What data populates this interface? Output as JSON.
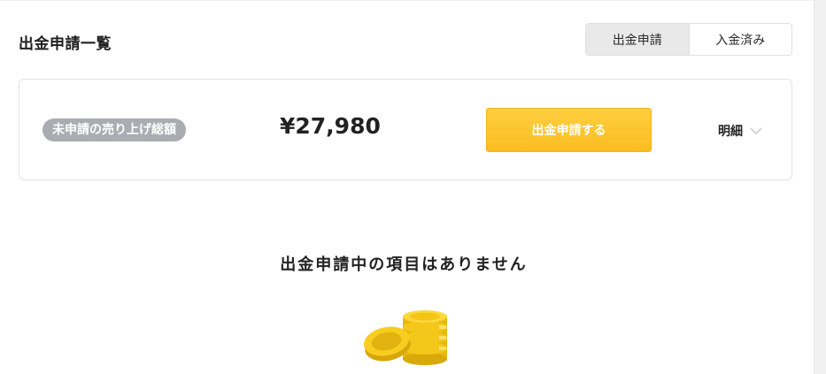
{
  "header": {
    "title": "出金申請一覧"
  },
  "tabs": [
    {
      "label": "出金申請",
      "active": true
    },
    {
      "label": "入金済み",
      "active": false
    }
  ],
  "summary": {
    "badge_label": "未申請の売り上げ総額",
    "amount": "¥27,980",
    "apply_button_label": "出金申請する",
    "detail_label": "明細",
    "detail_icon": "chevron-down-icon"
  },
  "empty_state": {
    "message": "出金申請中の項目はありません",
    "icon": "coins-icon"
  },
  "colors": {
    "accent": "#fbbd22",
    "badge": "#a9adb2",
    "active_tab": "#e9e9e9"
  }
}
